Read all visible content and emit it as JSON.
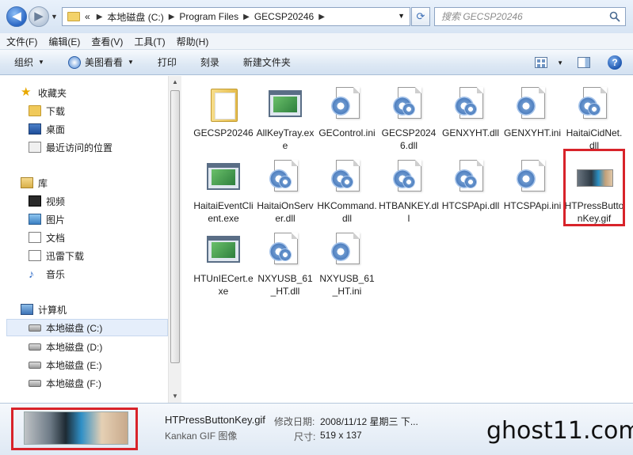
{
  "address": {
    "breadcrumbs": [
      "«",
      "本地磁盘 (C:)",
      "Program Files",
      "GECSP20246"
    ],
    "search_placeholder": "搜索 GECSP20246"
  },
  "menu": [
    "文件(F)",
    "编辑(E)",
    "查看(V)",
    "工具(T)",
    "帮助(H)"
  ],
  "toolbar": {
    "organize": "组织",
    "share": "美图看看",
    "print": "打印",
    "burn": "刻录",
    "new_folder": "新建文件夹"
  },
  "nav": {
    "favorites": "收藏夹",
    "downloads": "下载",
    "desktop": "桌面",
    "recent": "最近访问的位置",
    "libraries": "库",
    "videos": "视频",
    "pictures": "图片",
    "documents": "文档",
    "thunder": "迅雷下载",
    "music": "音乐",
    "computer": "计算机",
    "drive_c": "本地磁盘 (C:)",
    "drive_d": "本地磁盘 (D:)",
    "drive_e": "本地磁盘 (E:)",
    "drive_f": "本地磁盘 (F:)"
  },
  "files": [
    {
      "name": "GECSP20246",
      "type": "folder"
    },
    {
      "name": "AllKeyTray.exe",
      "type": "exe"
    },
    {
      "name": "GEControl.ini",
      "type": "ini"
    },
    {
      "name": "GECSP20246.dll",
      "type": "dll"
    },
    {
      "name": "GENXYHT.dll",
      "type": "dll"
    },
    {
      "name": "GENXYHT.ini",
      "type": "ini"
    },
    {
      "name": "HaitaiCidNet.dll",
      "type": "dll"
    },
    {
      "name": "HaitaiEventClient.exe",
      "type": "exe"
    },
    {
      "name": "HaitaiOnServer.dll",
      "type": "dll"
    },
    {
      "name": "HKCommand.dll",
      "type": "dll"
    },
    {
      "name": "HTBANKEY.dll",
      "type": "dll"
    },
    {
      "name": "HTCSPApi.dll",
      "type": "dll"
    },
    {
      "name": "HTCSPApi.ini",
      "type": "ini"
    },
    {
      "name": "HTPressButtonKey.gif",
      "type": "gif"
    },
    {
      "name": "HTUnIECert.exe",
      "type": "exe"
    },
    {
      "name": "NXYUSB_61_HT.dll",
      "type": "dll"
    },
    {
      "name": "NXYUSB_61_HT.ini",
      "type": "ini"
    }
  ],
  "details": {
    "name": "HTPressButtonKey.gif",
    "type": "Kankan GIF 图像",
    "modified_label": "修改日期:",
    "modified_value": "2008/11/12 星期三 下...",
    "size_label": "尺寸:",
    "size_value": "519 x 137"
  },
  "watermark": "ghost11.com",
  "colors": {
    "highlight": "#d8232a",
    "selection": "#e5eefb"
  }
}
